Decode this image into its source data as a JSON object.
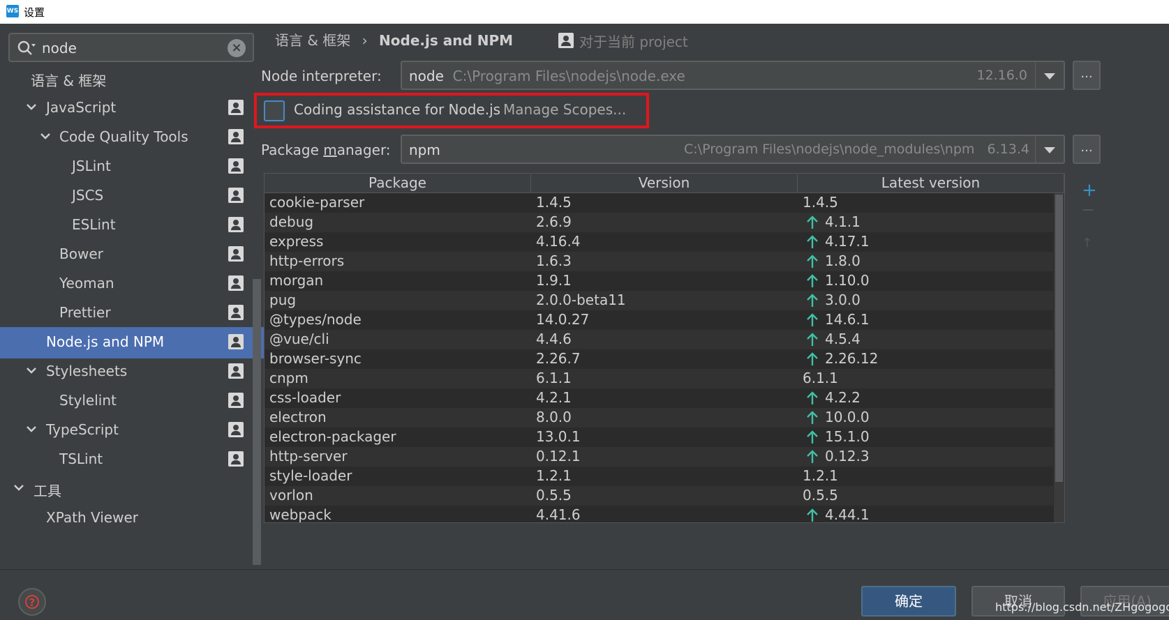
{
  "window": {
    "title": "设置",
    "app_icon_text": "WS"
  },
  "search": {
    "value": "node"
  },
  "tree": [
    {
      "label": "语言 & 框架",
      "expandable": false
    },
    {
      "label": "JavaScript",
      "expandable": true
    },
    {
      "label": "Code Quality Tools",
      "expandable": true
    },
    {
      "label": "JSLint",
      "expandable": false
    },
    {
      "label": "JSCS",
      "expandable": false
    },
    {
      "label": "ESLint",
      "expandable": false
    },
    {
      "label": "Bower",
      "expandable": false
    },
    {
      "label": "Yeoman",
      "expandable": false
    },
    {
      "label": "Prettier",
      "expandable": false
    },
    {
      "label": "Node.js and NPM",
      "expandable": false,
      "selected": true
    },
    {
      "label": "Stylesheets",
      "expandable": true
    },
    {
      "label": "Stylelint",
      "expandable": false
    },
    {
      "label": "TypeScript",
      "expandable": true
    },
    {
      "label": "TSLint",
      "expandable": false
    },
    {
      "label": "工具",
      "expandable": true
    },
    {
      "label": "XPath Viewer",
      "expandable": false
    }
  ],
  "breadcrumb": {
    "parent": "语言 & 框架",
    "separator": "›",
    "current": "Node.js and NPM",
    "scope": "对于当前 project"
  },
  "interpreter": {
    "label": "Node interpreter:",
    "name": "node",
    "path": "C:\\Program Files\\nodejs\\node.exe",
    "version": "12.16.0"
  },
  "coding_assistance": {
    "label": "Coding assistance for Node.js",
    "checked": false,
    "manage_link": "Manage Scopes..."
  },
  "package_manager": {
    "label_pre": "Package ",
    "label_mnemonic": "m",
    "label_post": "anager:",
    "name": "npm",
    "path": "C:\\Program Files\\nodejs\\node_modules\\npm",
    "version": "6.13.4"
  },
  "dots_label": "...",
  "table": {
    "headers": [
      "Package",
      "Version",
      "Latest version"
    ],
    "rows": [
      {
        "package": "cookie-parser",
        "version": "1.4.5",
        "latest": "1.4.5",
        "upgrade": false
      },
      {
        "package": "debug",
        "version": "2.6.9",
        "latest": "4.1.1",
        "upgrade": true
      },
      {
        "package": "express",
        "version": "4.16.4",
        "latest": "4.17.1",
        "upgrade": true
      },
      {
        "package": "http-errors",
        "version": "1.6.3",
        "latest": "1.8.0",
        "upgrade": true
      },
      {
        "package": "morgan",
        "version": "1.9.1",
        "latest": "1.10.0",
        "upgrade": true
      },
      {
        "package": "pug",
        "version": "2.0.0-beta11",
        "latest": "3.0.0",
        "upgrade": true
      },
      {
        "package": "@types/node",
        "version": "14.0.27",
        "latest": "14.6.1",
        "upgrade": true
      },
      {
        "package": "@vue/cli",
        "version": "4.4.6",
        "latest": "4.5.4",
        "upgrade": true
      },
      {
        "package": "browser-sync",
        "version": "2.26.7",
        "latest": "2.26.12",
        "upgrade": true
      },
      {
        "package": "cnpm",
        "version": "6.1.1",
        "latest": "6.1.1",
        "upgrade": false
      },
      {
        "package": "css-loader",
        "version": "4.2.1",
        "latest": "4.2.2",
        "upgrade": true
      },
      {
        "package": "electron",
        "version": "8.0.0",
        "latest": "10.0.0",
        "upgrade": true
      },
      {
        "package": "electron-packager",
        "version": "13.0.1",
        "latest": "15.1.0",
        "upgrade": true
      },
      {
        "package": "http-server",
        "version": "0.12.1",
        "latest": "0.12.3",
        "upgrade": true
      },
      {
        "package": "style-loader",
        "version": "1.2.1",
        "latest": "1.2.1",
        "upgrade": false
      },
      {
        "package": "vorlon",
        "version": "0.5.5",
        "latest": "0.5.5",
        "upgrade": false
      },
      {
        "package": "webpack",
        "version": "4.41.6",
        "latest": "4.44.1",
        "upgrade": true
      }
    ]
  },
  "side_tools": {
    "add": "+",
    "up": "↑"
  },
  "buttons": {
    "ok": "确定",
    "cancel": "取消",
    "apply": "应用(A)"
  },
  "help": {
    "glyph": "?"
  },
  "watermark": "https://blog.csdn.net/ZHgogogoha",
  "colors": {
    "accent": "#4b6eaf",
    "highlight": "#e0161e",
    "upgrade_arrow": "#3fc1a5",
    "ok_button": "#365880"
  }
}
